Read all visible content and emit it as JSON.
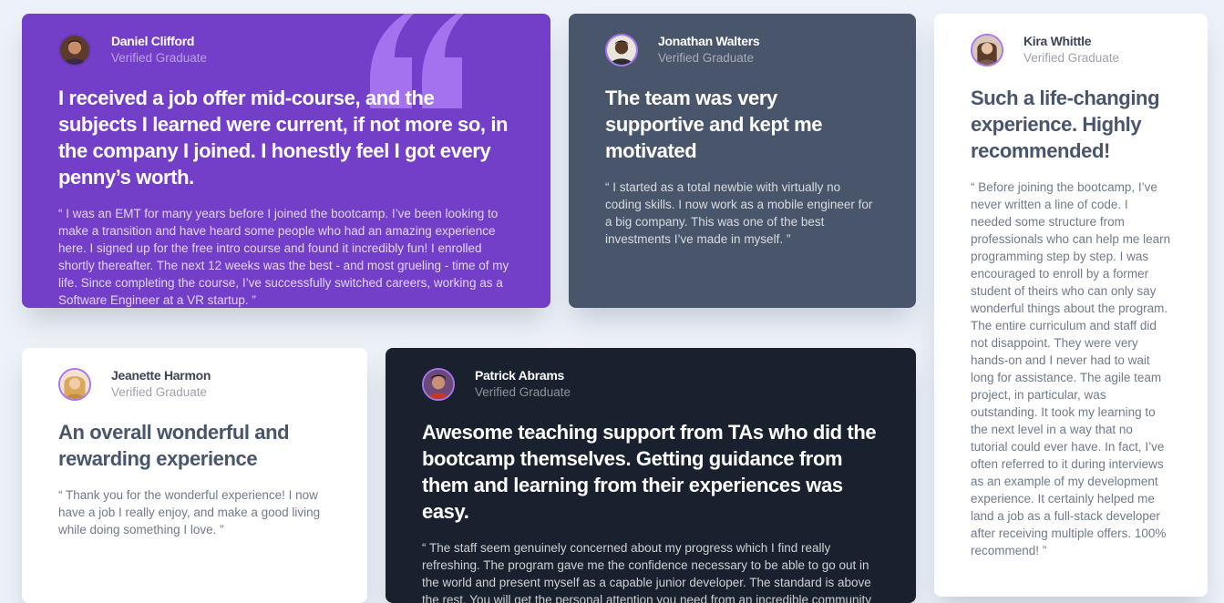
{
  "testimonials": [
    {
      "name": "Daniel Clifford",
      "role": "Verified Graduate",
      "headline": "I received a job offer mid-course, and the subjects I learned were current, if not more so, in the company I joined. I honestly feel I got every penny’s worth.",
      "body": "“ I was an EMT for many years before I joined the bootcamp. I’ve been looking to make a transition and have heard some people who had an amazing experience here. I signed up for the free intro course and found it incredibly fun! I enrolled shortly thereafter. The next 12 weeks was the best - and most grueling - time of my life. Since completing the course, I’ve successfully switched careers, working as a Software Engineer at a VR startup. ”",
      "color": "#733fc8"
    },
    {
      "name": "Jonathan Walters",
      "role": "Verified Graduate",
      "headline": "The team was very supportive and kept me motivated",
      "body": "“ I started as a total newbie with virtually no coding skills. I now work as a mobile engineer for a big company. This was one of the best investments I’ve made in myself. ”",
      "color": "#48556a"
    },
    {
      "name": "Kira Whittle",
      "role": "Verified Graduate",
      "headline": "Such a life-changing experience. Highly recommended!",
      "body": "“ Before joining the bootcamp, I’ve never written a line of code. I needed some structure from professionals who can help me learn programming step by step. I was encouraged to enroll by a former student of theirs who can only say wonderful things about the program. The entire curriculum and staff did not disappoint. They were very hands-on and I never had to wait long for assistance. The agile team project, in particular, was outstanding. It took my learning to the next level in a way that no tutorial could ever have. In fact, I’ve often referred to it during interviews as an example of my development experience. It certainly helped me land a job as a full-stack developer after receiving multiple offers. 100% recommend! ”",
      "color": "#ffffff"
    },
    {
      "name": "Jeanette Harmon",
      "role": "Verified Graduate",
      "headline": "An overall wonderful and rewarding experience",
      "body": "“ Thank you for the wonderful experience! I now have a job I really enjoy, and make a good living while doing something I love. ”",
      "color": "#ffffff"
    },
    {
      "name": "Patrick Abrams",
      "role": "Verified Graduate",
      "headline": "Awesome teaching support from TAs who did the bootcamp themselves. Getting guidance from them and learning from their experiences was easy.",
      "body": "“ The staff seem genuinely concerned about my progress which I find really refreshing. The program gave me the confidence necessary to be able to go out in the world and present myself as a capable junior developer. The standard is above the rest. You will get the personal attention you need from an incredible community of smart and amazing people. ”",
      "color": "#19212e"
    }
  ],
  "icons": {
    "quote": "quote-icon",
    "avatar": "avatar-icon"
  }
}
